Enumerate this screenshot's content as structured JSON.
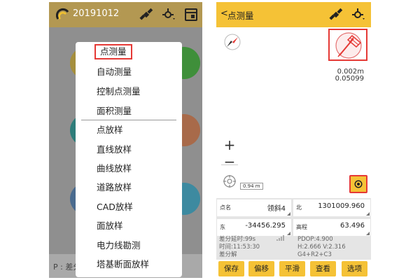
{
  "left_screen": {
    "project_title": "20191012",
    "footer_text": "P : 差分",
    "menu": {
      "items": [
        "点测量",
        "自动测量",
        "控制点测量",
        "面积测量",
        "点放样",
        "直线放样",
        "曲线放样",
        "道路放样",
        "CAD放样",
        "面放样",
        "电力线勘测",
        "塔基断面放样"
      ]
    },
    "colors": {
      "header": "#b39852",
      "overlay": "#8f8f8f",
      "highlight": "#e53935"
    },
    "icons": [
      "logo-icon",
      "satellite-icon",
      "gps-antenna-icon",
      "settings-panel-icon"
    ]
  },
  "right_screen": {
    "header": {
      "back": "<",
      "title": "点测量"
    },
    "precision": {
      "horizontal": "0.002m",
      "vertical": "0.05099"
    },
    "scale_label": "0.94 m",
    "zoom": {
      "in": "+",
      "out": "−"
    },
    "fields": {
      "name_label": "点名",
      "name_value": "领斜4",
      "north_label": "北",
      "north_value": "1301009.960",
      "east_label": "东",
      "east_value": "-34456.295",
      "elev_label": "高程",
      "elev_value": "63.496"
    },
    "status": {
      "diff_age": "差分延时:99s",
      "time": "时间:11:53:30",
      "solution": "差分解",
      "pdop": "PDOP:4.900",
      "hv": "H:2.666  V:2.316",
      "constellation": "G4+R2+C3"
    },
    "buttons": [
      "保存",
      "偏移",
      "平滑",
      "查看",
      "选项"
    ],
    "colors": {
      "header": "#f5c236",
      "button": "#f5c236",
      "highlight": "#e53935"
    },
    "icons": [
      "back-icon",
      "satellite-icon",
      "gps-antenna-icon",
      "compass-icon",
      "survey-pole-icon",
      "locate-crosshair-icon",
      "gps-center-icon"
    ]
  }
}
